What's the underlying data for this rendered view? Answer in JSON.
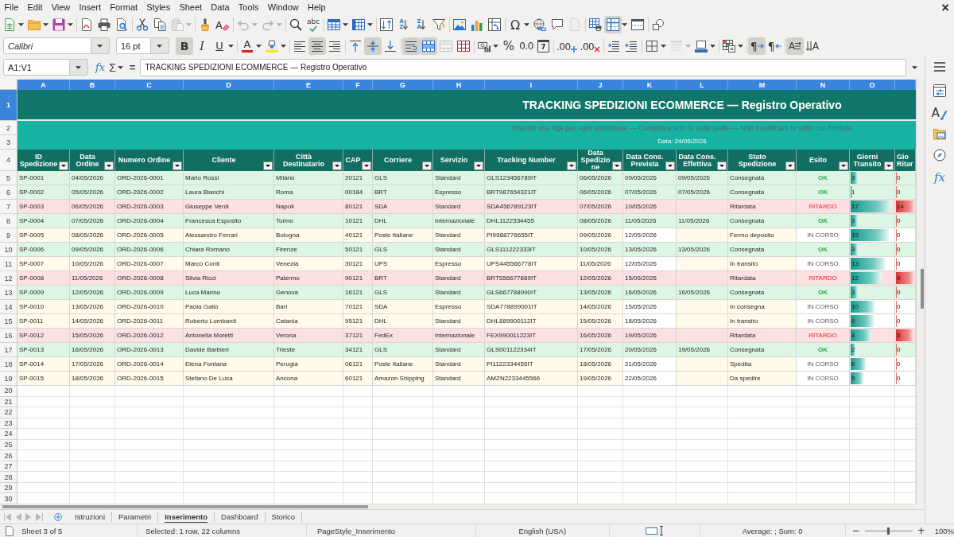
{
  "menu_bar": {
    "items": [
      "File",
      "Edit",
      "View",
      "Insert",
      "Format",
      "Styles",
      "Sheet",
      "Data",
      "Tools",
      "Window",
      "Help"
    ],
    "close": "×"
  },
  "toolbars": [
    {
      "groups": [
        [
          {
            "kind": "spreadsheet",
            "pressed": false,
            "disabled": false,
            "dropdown": true
          },
          {
            "kind": "folder",
            "pressed": false,
            "disabled": false,
            "dropdown": true
          },
          {
            "kind": "floppy-disk",
            "pressed": false,
            "disabled": false,
            "dropdown": true
          }
        ],
        [
          {
            "kind": "document-curve",
            "pressed": false,
            "disabled": false,
            "dropdown": false
          },
          {
            "kind": "printer",
            "pressed": false,
            "disabled": false,
            "dropdown": false
          },
          {
            "kind": "document-magnifier",
            "pressed": false,
            "disabled": false,
            "dropdown": false
          }
        ],
        [
          {
            "kind": "scissors",
            "pressed": false,
            "disabled": false,
            "dropdown": false
          },
          {
            "kind": "copy",
            "pressed": false,
            "disabled": false,
            "dropdown": false
          },
          {
            "kind": "clipboard",
            "pressed": false,
            "disabled": true,
            "dropdown": true
          }
        ],
        [
          {
            "kind": "paintbrush",
            "pressed": false,
            "disabled": false,
            "dropdown": false
          },
          {
            "kind": "clear-formatting",
            "text": "A",
            "pressed": false,
            "disabled": false,
            "dropdown": false
          }
        ],
        [
          {
            "kind": "undo",
            "pressed": false,
            "disabled": true,
            "dropdown": true
          },
          {
            "kind": "redo",
            "pressed": false,
            "disabled": true,
            "dropdown": true
          }
        ],
        [
          {
            "kind": "search",
            "pressed": false,
            "disabled": false,
            "dropdown": false
          },
          {
            "kind": "spelling",
            "text": "abc",
            "pressed": false,
            "disabled": false,
            "dropdown": false
          }
        ],
        [
          {
            "kind": "table-rows",
            "pressed": false,
            "disabled": false,
            "dropdown": true
          },
          {
            "kind": "table-columns",
            "pressed": false,
            "disabled": false,
            "dropdown": true
          }
        ],
        [
          {
            "kind": "sort",
            "pressed": false,
            "disabled": false,
            "dropdown": false
          },
          {
            "kind": "sort-ascending",
            "text": "AZ",
            "pressed": false,
            "disabled": false,
            "dropdown": false
          },
          {
            "kind": "sort-descending",
            "text": "ZA",
            "pressed": false,
            "disabled": false,
            "dropdown": false
          },
          {
            "kind": "funnel",
            "pressed": false,
            "disabled": false,
            "dropdown": false
          }
        ],
        [
          {
            "kind": "picture",
            "pressed": false,
            "disabled": false,
            "dropdown": false
          },
          {
            "kind": "bar-chart",
            "pressed": false,
            "disabled": false,
            "dropdown": false
          },
          {
            "kind": "pivot-table",
            "pressed": false,
            "disabled": false,
            "dropdown": false
          }
        ],
        [
          {
            "kind": "special-character",
            "text": "Ω",
            "pressed": false,
            "disabled": false,
            "dropdown": true
          },
          {
            "kind": "globe-link",
            "pressed": false,
            "disabled": false,
            "dropdown": false
          },
          {
            "kind": "speech-bubble",
            "pressed": false,
            "disabled": false,
            "dropdown": false
          },
          {
            "kind": "page",
            "pressed": false,
            "disabled": true,
            "dropdown": false
          }
        ],
        [
          {
            "kind": "table-printer",
            "pressed": false,
            "disabled": false,
            "dropdown": false
          },
          {
            "kind": "table-grid",
            "pressed": true,
            "disabled": false,
            "dropdown": true
          },
          {
            "kind": "split-window",
            "pressed": false,
            "disabled": false,
            "dropdown": false
          }
        ],
        [
          {
            "kind": "shapes",
            "pressed": false,
            "disabled": false,
            "dropdown": false
          }
        ]
      ]
    },
    {
      "font_name": "Calibri",
      "font_size": "16 pt",
      "groups": [
        [
          {
            "kind": "bold",
            "text": "B",
            "pressed": true,
            "disabled": false,
            "dropdown": false
          },
          {
            "kind": "italic",
            "text": "I",
            "pressed": false,
            "disabled": false,
            "dropdown": false
          },
          {
            "kind": "underline",
            "text": "U",
            "pressed": false,
            "disabled": false,
            "dropdown": true
          }
        ],
        [
          {
            "kind": "font-color",
            "text": "A",
            "pressed": false,
            "disabled": false,
            "dropdown": true
          },
          {
            "kind": "highlighter",
            "pressed": false,
            "disabled": false,
            "dropdown": true
          }
        ],
        [
          {
            "kind": "align-left",
            "pressed": false,
            "disabled": false,
            "dropdown": false
          },
          {
            "kind": "align-center",
            "pressed": true,
            "disabled": false,
            "dropdown": false
          },
          {
            "kind": "align-right",
            "pressed": false,
            "disabled": false,
            "dropdown": false
          }
        ],
        [
          {
            "kind": "align-top",
            "pressed": false,
            "disabled": false,
            "dropdown": false
          },
          {
            "kind": "align-middle",
            "pressed": true,
            "disabled": false,
            "dropdown": false
          },
          {
            "kind": "align-bottom",
            "pressed": false,
            "disabled": false,
            "dropdown": false
          }
        ],
        [
          {
            "kind": "wrap-text",
            "pressed": true,
            "disabled": false,
            "dropdown": false
          },
          {
            "kind": "merge-center",
            "pressed": true,
            "disabled": false,
            "dropdown": false
          },
          {
            "kind": "merge-cells",
            "pressed": false,
            "disabled": true,
            "dropdown": false
          },
          {
            "kind": "cell-grid",
            "pressed": false,
            "disabled": false,
            "dropdown": false
          }
        ],
        [
          {
            "kind": "money",
            "pressed": false,
            "disabled": false,
            "dropdown": true
          },
          {
            "kind": "percent",
            "text": "%",
            "pressed": false,
            "disabled": false,
            "dropdown": false
          },
          {
            "kind": "number",
            "text": "0.0",
            "pressed": false,
            "disabled": false,
            "dropdown": false
          },
          {
            "kind": "date",
            "text": "7",
            "pressed": false,
            "disabled": false,
            "dropdown": false
          }
        ],
        [
          {
            "kind": "add-decimal",
            "text": ".00",
            "pressed": false,
            "disabled": false,
            "dropdown": false
          },
          {
            "kind": "delete-decimal",
            "text": ".00",
            "pressed": false,
            "disabled": false,
            "dropdown": false
          }
        ],
        [
          {
            "kind": "indent",
            "pressed": false,
            "disabled": false,
            "dropdown": false
          },
          {
            "kind": "outdent",
            "pressed": false,
            "disabled": false,
            "dropdown": false
          }
        ],
        [
          {
            "kind": "borders",
            "pressed": false,
            "disabled": false,
            "dropdown": true
          },
          {
            "kind": "line-style",
            "pressed": false,
            "disabled": true,
            "dropdown": true
          },
          {
            "kind": "border-color",
            "pressed": false,
            "disabled": false,
            "dropdown": true
          }
        ],
        [
          {
            "kind": "grid-note",
            "pressed": false,
            "disabled": false,
            "dropdown": true
          }
        ],
        [
          {
            "kind": "left-to-right",
            "text": "¶",
            "pressed": true,
            "disabled": false,
            "dropdown": false
          },
          {
            "kind": "right-to-left",
            "text": "¶",
            "pressed": false,
            "disabled": false,
            "dropdown": false
          }
        ],
        [
          {
            "kind": "text-direction",
            "text": "A",
            "pressed": true,
            "disabled": false,
            "dropdown": false
          },
          {
            "kind": "vertical-text",
            "text": "A",
            "pressed": false,
            "disabled": false,
            "dropdown": false
          }
        ]
      ]
    }
  ],
  "formula_bar": {
    "name_box": "A1:V1",
    "function_wizard": "fx",
    "sum": "Σ",
    "equals": "=",
    "formula": "TRACKING SPEDIZIONI ECOMMERCE — Registro Operativo"
  },
  "sheet": {
    "columns": [
      {
        "label": "A",
        "selected": true
      },
      {
        "label": "B",
        "selected": true
      },
      {
        "label": "C",
        "selected": true
      },
      {
        "label": "D",
        "selected": true
      },
      {
        "label": "E",
        "selected": true
      },
      {
        "label": "F",
        "selected": true
      },
      {
        "label": "G",
        "selected": true
      },
      {
        "label": "H",
        "selected": true
      },
      {
        "label": "I",
        "selected": true
      },
      {
        "label": "J",
        "selected": true
      },
      {
        "label": "K",
        "selected": true
      },
      {
        "label": "L",
        "selected": true
      },
      {
        "label": "M",
        "selected": true
      },
      {
        "label": "N",
        "selected": true
      },
      {
        "label": "O",
        "selected": true
      }
    ],
    "row_numbers": [
      {
        "label": "1",
        "selected": true
      },
      {
        "label": "2",
        "selected": false
      },
      {
        "label": "3",
        "selected": false
      },
      {
        "label": "4",
        "selected": false
      },
      {
        "label": "5",
        "selected": false
      },
      {
        "label": "6",
        "selected": false
      },
      {
        "label": "7",
        "selected": false
      },
      {
        "label": "8",
        "selected": false
      },
      {
        "label": "9",
        "selected": false
      },
      {
        "label": "10",
        "selected": false
      },
      {
        "label": "11",
        "selected": false
      },
      {
        "label": "12",
        "selected": false
      },
      {
        "label": "13",
        "selected": false
      },
      {
        "label": "14",
        "selected": false
      },
      {
        "label": "15",
        "selected": false
      },
      {
        "label": "16",
        "selected": false
      },
      {
        "label": "17",
        "selected": false
      },
      {
        "label": "18",
        "selected": false
      },
      {
        "label": "19",
        "selected": false
      },
      {
        "label": "20",
        "selected": false
      },
      {
        "label": "21",
        "selected": false
      },
      {
        "label": "22",
        "selected": false
      },
      {
        "label": "23",
        "selected": false
      },
      {
        "label": "24",
        "selected": false
      },
      {
        "label": "25",
        "selected": false
      },
      {
        "label": "26",
        "selected": false
      },
      {
        "label": "27",
        "selected": false
      },
      {
        "label": "28",
        "selected": false
      },
      {
        "label": "29",
        "selected": false
      },
      {
        "label": "30",
        "selected": false
      }
    ],
    "title": "TRACKING SPEDIZIONI ECOMMERCE — Registro Operativo",
    "instructions": "Inserire una riga per ogni spedizione — Compilare solo le celle gialle — Non modificare le celle con formule",
    "date": "Data: 24/05/2026",
    "header": [
      {
        "label": "ID Spedizione",
        "filter": true
      },
      {
        "label": "Data Ordine",
        "filter": true
      },
      {
        "label": "Numero Ordine",
        "filter": true
      },
      {
        "label": "Cliente",
        "filter": true
      },
      {
        "label": "Città Destinatario",
        "filter": true
      },
      {
        "label": "CAP",
        "filter": true
      },
      {
        "label": "Corriere",
        "filter": true
      },
      {
        "label": "Servizio",
        "filter": true
      },
      {
        "label": "Tracking Number",
        "filter": true
      },
      {
        "label": "Data Spedizione",
        "filter": true
      },
      {
        "label": "Data Cons. Prevista",
        "filter": true
      },
      {
        "label": "Data Cons. Effettiva",
        "filter": true
      },
      {
        "label": "Stato Spedizione",
        "filter": true
      },
      {
        "label": "Esito",
        "filter": true
      },
      {
        "label": "Giorni Transito",
        "filter": true
      },
      {
        "label": "Gio Ritar",
        "filter": false
      }
    ],
    "rows": [
      {
        "id": "SP-0001",
        "order_date": "04/05/2026",
        "order_number": "ORD-2026-0001",
        "customer": "Mario Rossi",
        "city": "Milano",
        "cap": "20121",
        "carrier": "GLS",
        "service": "Standard",
        "tracking": "GLS123456789IT",
        "ship_date": "06/05/2026",
        "expected_delivery": "09/05/2026",
        "actual_delivery": "09/05/2026",
        "status": "Consegnata",
        "outcome": "OK",
        "transit": {
          "days": "3",
          "level": 0.2
        },
        "delay": {
          "days": "0",
          "level": 0.12
        },
        "kind": "delivered"
      },
      {
        "id": "SP-0002",
        "order_date": "05/05/2026",
        "order_number": "ORD-2026-0002",
        "customer": "Laura Bianchi",
        "city": "Roma",
        "cap": "00184",
        "carrier": "BRT",
        "service": "Espresso",
        "tracking": "BRT987654321IT",
        "ship_date": "06/05/2026",
        "expected_delivery": "07/05/2026",
        "actual_delivery": "07/05/2026",
        "status": "Consegnata",
        "outcome": "OK",
        "transit": {
          "days": "1",
          "level": 0.08
        },
        "delay": {
          "days": "0",
          "level": 0.12
        },
        "kind": "delivered"
      },
      {
        "id": "SP-0003",
        "order_date": "06/05/2026",
        "order_number": "ORD-2026-0003",
        "customer": "Giuseppe Verdi",
        "city": "Napoli",
        "cap": "80121",
        "carrier": "SDA",
        "service": "Standard",
        "tracking": "SDA456789123IT",
        "ship_date": "07/05/2026",
        "expected_delivery": "10/05/2026",
        "status": "Ritardata",
        "outcome": "RITARDO",
        "transit": {
          "days": "17",
          "level": 0.95
        },
        "delay": {
          "days": "14",
          "level": 1
        },
        "kind": "delayed"
      },
      {
        "id": "SP-0004",
        "order_date": "07/05/2026",
        "order_number": "ORD-2026-0004",
        "customer": "Francesca Esposito",
        "city": "Torino",
        "cap": "10121",
        "carrier": "DHL",
        "service": "Internazionale",
        "tracking": "DHL1122334455",
        "ship_date": "08/05/2026",
        "expected_delivery": "11/05/2026",
        "actual_delivery": "11/05/2026",
        "status": "Consegnata",
        "outcome": "OK",
        "transit": {
          "days": "3",
          "level": 0.2
        },
        "delay": {
          "days": "0",
          "level": 0.12
        },
        "kind": "delivered"
      },
      {
        "id": "SP-0005",
        "order_date": "08/05/2026",
        "order_number": "ORD-2026-0005",
        "customer": "Alessandro Ferrari",
        "city": "Bologna",
        "cap": "40121",
        "carrier": "Poste Italiane",
        "service": "Standard",
        "tracking": "PI9988776655IT",
        "ship_date": "09/05/2026",
        "expected_delivery": "12/05/2026",
        "status": "Fermo deposito",
        "outcome": "IN CORSO",
        "transit": {
          "days": "15",
          "level": 0.9
        },
        "delay": {
          "days": "0",
          "level": 0.12
        },
        "kind": "open"
      },
      {
        "id": "SP-0006",
        "order_date": "09/05/2026",
        "order_number": "ORD-2026-0006",
        "customer": "Chiara Romano",
        "city": "Firenze",
        "cap": "50121",
        "carrier": "GLS",
        "service": "Standard",
        "tracking": "GLS111222333IT",
        "ship_date": "10/05/2026",
        "expected_delivery": "13/05/2026",
        "actual_delivery": "13/05/2026",
        "status": "Consegnata",
        "outcome": "OK",
        "transit": {
          "days": "3",
          "level": 0.2
        },
        "delay": {
          "days": "0",
          "level": 0.12
        },
        "kind": "delivered"
      },
      {
        "id": "SP-0007",
        "order_date": "10/05/2026",
        "order_number": "ORD-2026-0007",
        "customer": "Marco Conti",
        "city": "Venezia",
        "cap": "30121",
        "carrier": "UPS",
        "service": "Espresso",
        "tracking": "UPS445566778IT",
        "ship_date": "11/05/2026",
        "expected_delivery": "12/05/2026",
        "status": "In transito",
        "outcome": "IN CORSO",
        "transit": {
          "days": "13",
          "level": 0.8
        },
        "delay": {
          "days": "0",
          "level": 0.12
        },
        "kind": "open"
      },
      {
        "id": "SP-0008",
        "order_date": "11/05/2026",
        "order_number": "ORD-2026-0008",
        "customer": "Silvia Ricci",
        "city": "Palermo",
        "cap": "90121",
        "carrier": "BRT",
        "service": "Standard",
        "tracking": "BRT556677889IT",
        "ship_date": "12/05/2026",
        "expected_delivery": "15/05/2026",
        "status": "Ritardata",
        "outcome": "RITARDO",
        "transit": {
          "days": "12",
          "level": 0.72
        },
        "delay": {
          "days": "9",
          "level": 0.95
        },
        "kind": "delayed"
      },
      {
        "id": "SP-0009",
        "order_date": "12/05/2026",
        "order_number": "ORD-2026-0009",
        "customer": "Luca Marino",
        "city": "Genova",
        "cap": "16121",
        "carrier": "GLS",
        "service": "Standard",
        "tracking": "GLS667788990IT",
        "ship_date": "13/05/2026",
        "expected_delivery": "16/05/2026",
        "actual_delivery": "16/05/2026",
        "status": "Consegnata",
        "outcome": "OK",
        "transit": {
          "days": "3",
          "level": 0.2
        },
        "delay": {
          "days": "0",
          "level": 0.12
        },
        "kind": "delivered"
      },
      {
        "id": "SP-0010",
        "order_date": "13/05/2026",
        "order_number": "ORD-2026-0010",
        "customer": "Paola Gallo",
        "city": "Bari",
        "cap": "70121",
        "carrier": "SDA",
        "service": "Espresso",
        "tracking": "SDA778899001IT",
        "ship_date": "14/05/2026",
        "expected_delivery": "15/05/2026",
        "status": "In consegna",
        "outcome": "IN CORSO",
        "transit": {
          "days": "10",
          "level": 0.58
        },
        "delay": {
          "days": "0",
          "level": 0.12
        },
        "kind": "open"
      },
      {
        "id": "SP-0011",
        "order_date": "14/05/2026",
        "order_number": "ORD-2026-0011",
        "customer": "Roberto Lombardi",
        "city": "Catania",
        "cap": "95121",
        "carrier": "DHL",
        "service": "Standard",
        "tracking": "DHL889900112IT",
        "ship_date": "15/05/2026",
        "expected_delivery": "18/05/2026",
        "status": "In transito",
        "outcome": "IN CORSO",
        "transit": {
          "days": "9",
          "level": 0.55
        },
        "delay": {
          "days": "0",
          "level": 0.12
        },
        "kind": "open"
      },
      {
        "id": "SP-0012",
        "order_date": "15/05/2026",
        "order_number": "ORD-2026-0012",
        "customer": "Antonella Moretti",
        "city": "Verona",
        "cap": "37121",
        "carrier": "FedEx",
        "service": "Internazionale",
        "tracking": "FEX990011223IT",
        "ship_date": "16/05/2026",
        "expected_delivery": "19/05/2026",
        "status": "Ritardata",
        "outcome": "RITARDO",
        "transit": {
          "days": "8",
          "level": 0.5
        },
        "delay": {
          "days": "5",
          "level": 0.9
        },
        "kind": "delayed"
      },
      {
        "id": "SP-0013",
        "order_date": "16/05/2026",
        "order_number": "ORD-2026-0013",
        "customer": "Davide Barbieri",
        "city": "Trieste",
        "cap": "34121",
        "carrier": "GLS",
        "service": "Standard",
        "tracking": "GLS001122334IT",
        "ship_date": "17/05/2026",
        "expected_delivery": "20/05/2026",
        "actual_delivery": "19/05/2026",
        "status": "Consegnata",
        "outcome": "OK",
        "transit": {
          "days": "2",
          "level": 0.14
        },
        "delay": {
          "days": "0",
          "level": 0.12
        },
        "kind": "delivered"
      },
      {
        "id": "SP-0014",
        "order_date": "17/05/2026",
        "order_number": "ORD-2026-0014",
        "customer": "Elena Fontana",
        "city": "Perugia",
        "cap": "06121",
        "carrier": "Poste Italiane",
        "service": "Standard",
        "tracking": "PI1122334455IT",
        "ship_date": "18/05/2026",
        "expected_delivery": "21/05/2026",
        "status": "Spedita",
        "outcome": "IN CORSO",
        "transit": {
          "days": "6",
          "level": 0.38
        },
        "delay": {
          "days": "0",
          "level": 0.12
        },
        "kind": "open"
      },
      {
        "id": "SP-0015",
        "order_date": "18/05/2026",
        "order_number": "ORD-2026-0015",
        "customer": "Stefano De Luca",
        "city": "Ancona",
        "cap": "60121",
        "carrier": "Amazon Shipping",
        "service": "Standard",
        "tracking": "AMZN2233445566",
        "ship_date": "19/05/2026",
        "expected_delivery": "22/05/2026",
        "status": "Da spedire",
        "outcome": "IN CORSO",
        "transit": {
          "days": "5",
          "level": 0.32
        },
        "delay": {
          "days": "0",
          "level": 0.12
        },
        "kind": "open"
      }
    ]
  },
  "sheet_tabs": {
    "navigation": [
      {
        "kind": "skip-start",
        "disabled": true
      },
      {
        "kind": "triangle-left",
        "disabled": true
      },
      {
        "kind": "triangle-right",
        "disabled": true
      },
      {
        "kind": "skip-end",
        "disabled": true
      }
    ],
    "tabs": [
      {
        "label": "Istruzioni",
        "selected": false
      },
      {
        "label": "Parametri",
        "selected": false
      },
      {
        "label": "Inserimento",
        "selected": true
      },
      {
        "label": "Dashboard",
        "selected": false
      },
      {
        "label": "Storico",
        "selected": false
      }
    ]
  },
  "sidebar": {
    "tabs": [
      {
        "kind": "sliders-window",
        "selected": false
      },
      {
        "kind": "styles",
        "text": "A",
        "selected": false
      },
      {
        "kind": "folder-picture",
        "selected": false
      },
      {
        "kind": "compass",
        "selected": false
      },
      {
        "kind": "functions",
        "text": "fx",
        "selected": false
      }
    ]
  },
  "status_bar": {
    "sheet": "Sheet 3 of 5",
    "selection": "Selected: 1 row, 22 columns",
    "page_style": "PageStyle_Inserimento",
    "language": "English (USA)",
    "summary": "Average: ; Sum: 0",
    "zoom_out": "−",
    "zoom": {
      "level": 0.5
    },
    "zoom_in": "+",
    "zoom_reading": "100%"
  }
}
